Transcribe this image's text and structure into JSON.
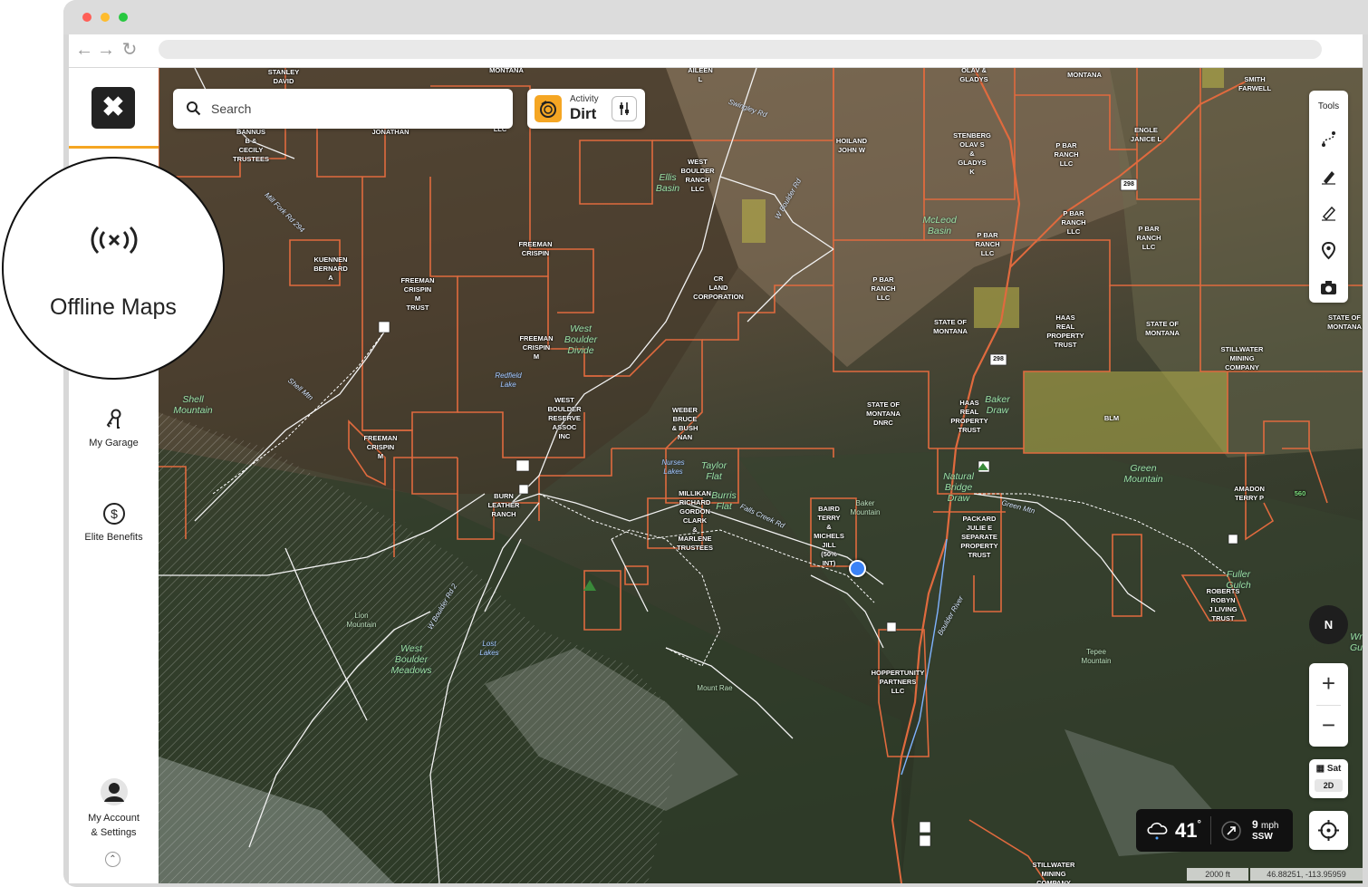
{
  "browser": {
    "window_buttons": [
      {
        "name": "close",
        "color": "#ff5f57"
      },
      {
        "name": "minimize",
        "color": "#febc2e"
      },
      {
        "name": "zoom",
        "color": "#28c840"
      }
    ],
    "nav_icons": [
      "back-arrow-icon",
      "forward-arrow-icon",
      "reload-icon"
    ],
    "url": ""
  },
  "sidebar": {
    "close_icon": "close-icon",
    "accent_color": "#f5a623",
    "offline_maps": {
      "icon": "offline-signal-icon",
      "label": "Offline Maps"
    },
    "items": [
      {
        "id": "my-garage",
        "icon": "keys-icon",
        "label": "My Garage"
      },
      {
        "id": "elite-benefits",
        "icon": "dollar-circle-icon",
        "label": "Elite Benefits"
      }
    ],
    "account": {
      "icon": "avatar-icon",
      "label_line1": "My Account",
      "label_line2": "& Settings",
      "expand_icon": "chevron-up-icon"
    }
  },
  "search": {
    "placeholder": "Search",
    "icon": "search-icon"
  },
  "activity": {
    "small_label": "Activity",
    "value": "Dirt",
    "icon": "dirt-bike-icon",
    "filter_icon": "sliders-icon"
  },
  "tools": {
    "title": "Tools",
    "items": [
      "route-icon",
      "pencil-icon",
      "eraser-pencil-icon",
      "pin-icon",
      "camera-icon"
    ]
  },
  "compass": {
    "label": "N"
  },
  "zoom": {
    "in": "+",
    "out": "−"
  },
  "layer": {
    "label": "Sat",
    "mode": "2D",
    "icon": "map-layers-icon"
  },
  "locate": {
    "icon": "locate-crosshair-icon"
  },
  "weather": {
    "icon": "rain-cloud-icon",
    "temperature": "41",
    "degree": "°",
    "wind_icon": "wind-arrow-icon",
    "wind_speed": "9",
    "wind_unit": "mph",
    "wind_direction": "SSW"
  },
  "scale": "2000 ft",
  "coordinates": "46.88251, -113.95959",
  "map": {
    "parcel_labels": [
      "STANLEY\nDAVID",
      "MONTANA",
      "AILEEN\nL",
      "OLAV &\nGLADYS",
      "MONTANA",
      "SMITH\nFARWELL",
      "BANNUS\nB &\nCECILY\nTRUSTEES",
      "JONATHAN",
      "LLC",
      "WEST\nBOULDER\nRANCH\nLLC",
      "HOILAND\nJOHN W",
      "STENBERG\nOLAV S\n&\nGLADYS\nK",
      "P BAR\nRANCH\nLLC",
      "ENGLE\nJANICE L",
      "KUENNEN\nBERNARD\nA",
      "FREEMAN\nCRISPIN",
      "FREEMAN\nCRISPIN\nM\nTRUST",
      "CR\nLAND\nCORPORATION",
      "P BAR\nRANCH\nLLC",
      "P BAR\nRANCH\nLLC",
      "P BAR\nRANCH\nLLC",
      "P BAR\nRANCH\nLLC",
      "STATE OF\nMONTANA",
      "HAAS\nREAL\nPROPERTY\nTRUST",
      "STATE OF\nMONTANA",
      "STATE OF\nMONTANA",
      "STILLWATER\nMINING\nCOMPANY",
      "FREEMAN\nCRISPIN\nM",
      "WEST\nBOULDER\nRESERVE\nASSOC\nINC",
      "WEBER\nBRUCE\n& BUSH\nNAN",
      "STATE OF\nMONTANA\nDNRC",
      "HAAS\nREAL\nPROPERTY\nTRUST",
      "BLM",
      "FREEMAN\nCRISPIN\nM",
      "BURN\nLEATHER\nRANCH",
      "MILLIKAN\nRICHARD\nGORDON\nCLARK\n&\nMARLENE\nTRUSTEES",
      "BAIRD\nTERRY\n&\nMICHELS\nJILL\n(50%\nINT)",
      "PACKARD\nJULIE E\nSEPARATE\nPROPERTY\nTRUST",
      "AMADON\nTERRY P",
      "ROBERTS\nROBYN\nJ LIVING\nTRUST",
      "HOPPERTUNITY\nPARTNERS\nLLC",
      "STILLWATER\nMINING\nCOMPANY"
    ],
    "nature_labels": [
      "Ellis\nBasin",
      "McLeod\nBasin",
      "West\nBoulder\nDivide",
      "Shell\nMountain",
      "Taylor\nFlat",
      "Burris\nFlat",
      "Baker\nDraw",
      "Green\nMountain",
      "Natural\nBridge\nDraw",
      "West\nBoulder\nMeadows",
      "Fuller\nGulch",
      "Wr\nGu"
    ],
    "water_labels": [
      "Redfield\nLake",
      "Nurses\nLakes",
      "Lost\nLakes"
    ],
    "peak_labels": [
      "Baker\nMountain",
      "Lion\nMountain",
      "Mount Rae",
      "Tepee\nMountain"
    ],
    "road_labels": [
      "Swingley Rd",
      "Mill Fork Rd 294",
      "W Boulder Rd",
      "Shell Mtn",
      "Green Mtn",
      "Boulder River",
      "Falls Creek Rd",
      "W Boulder Rd 2"
    ],
    "road_markers": [
      "298",
      "298"
    ],
    "elevation_label": "560",
    "location_marker": "current-location-icon",
    "parcel_border_color": "#e06a3e"
  }
}
